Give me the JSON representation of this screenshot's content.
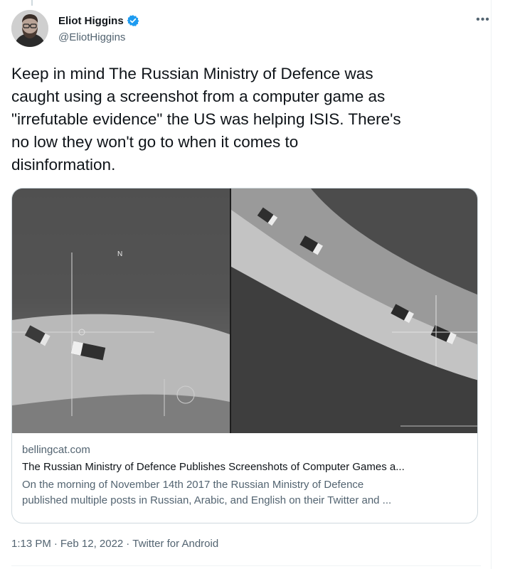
{
  "author": {
    "display_name": "Eliot Higgins",
    "handle": "@EliotHiggins",
    "verified": true,
    "avatar_icon": "user-avatar"
  },
  "tweet": {
    "text": "Keep in mind The Russian Ministry of Defence was\ncaught using a screenshot from a computer game as\n\"irrefutable evidence\" the US was helping ISIS. There's\nno low they won't go to when it comes to\ndisinformation."
  },
  "card": {
    "domain": "bellingcat.com",
    "title": "The Russian Ministry of Defence Publishes Screenshots of Computer Games a...",
    "description_line1": "On the morning of November 14th 2017 the Russian Ministry of Defence",
    "description_line2": "published multiple posts in Russian, Arabic, and English on their Twitter and ..."
  },
  "meta": {
    "time": "1:13 PM",
    "separator": "·",
    "date": "Feb 12, 2022",
    "source": "Twitter for Android"
  },
  "colors": {
    "text_primary": "#0f1419",
    "text_secondary": "#536471",
    "verified_blue": "#1d9bf0",
    "border": "#cfd9de"
  }
}
